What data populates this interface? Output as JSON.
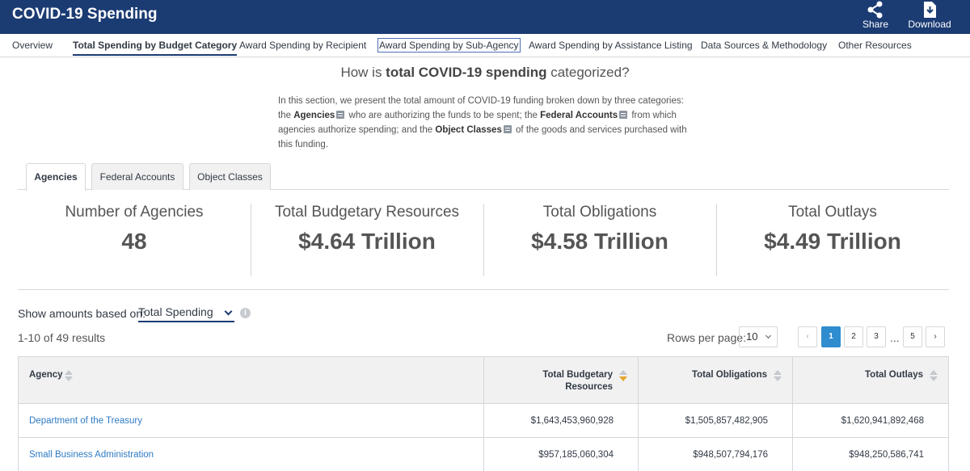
{
  "header": {
    "title": "COVID-19 Spending",
    "share_label": "Share",
    "download_label": "Download"
  },
  "nav": {
    "items": [
      "Overview",
      "Total Spending by Budget Category",
      "Award Spending by Recipient",
      "Award Spending by Sub-Agency",
      "Award Spending by Assistance Listing",
      "Data Sources & Methodology",
      "Other Resources"
    ]
  },
  "intro": {
    "question_prefix": "How is ",
    "question_bold": "total COVID-19 spending",
    "question_suffix": " categorized?",
    "p1": "In this section, we present the total amount of COVID-19 funding broken down by three categories: the ",
    "term_agencies": "Agencies",
    "p2": " who are authorizing the funds to be spent; the ",
    "term_federal_accounts": "Federal Accounts",
    "p3": " from which agencies authorize spending; and the ",
    "term_object_classes": "Object Classes",
    "p4": " of the goods and services purchased with this funding."
  },
  "tabs": [
    "Agencies",
    "Federal Accounts",
    "Object Classes"
  ],
  "summary": [
    {
      "label": "Number of Agencies",
      "value": "48"
    },
    {
      "label": "Total Budgetary Resources",
      "value": "$4.64 Trillion"
    },
    {
      "label": "Total Obligations",
      "value": "$4.58 Trillion"
    },
    {
      "label": "Total Outlays",
      "value": "$4.49 Trillion"
    }
  ],
  "controls": {
    "show_label": "Show amounts based on:",
    "show_value": "Total Spending",
    "results_text": "1-10 of 49 results",
    "rows_label": "Rows per page:",
    "rows_value": "10",
    "pages": [
      "1",
      "2",
      "3",
      "5"
    ],
    "ellipsis": "...",
    "prev_glyph": "‹",
    "next_glyph": "›"
  },
  "table": {
    "headers": {
      "agency": "Agency",
      "budgetary_line1": "Total Budgetary",
      "budgetary_line2": "Resources",
      "obligations": "Total Obligations",
      "outlays": "Total Outlays"
    },
    "rows": [
      {
        "agency": "Department of the Treasury",
        "budgetary": "$1,643,453,960,928",
        "obligations": "$1,505,857,482,905",
        "outlays": "$1,620,941,892,468"
      },
      {
        "agency": "Small Business Administration",
        "budgetary": "$957,185,060,304",
        "obligations": "$948,507,794,176",
        "outlays": "$948,250,586,741"
      }
    ]
  },
  "colors": {
    "header_bg": "#1b3b73",
    "link": "#2e7bc4",
    "active_page": "#2e8ccf",
    "sort_active": "#e6a52b"
  }
}
